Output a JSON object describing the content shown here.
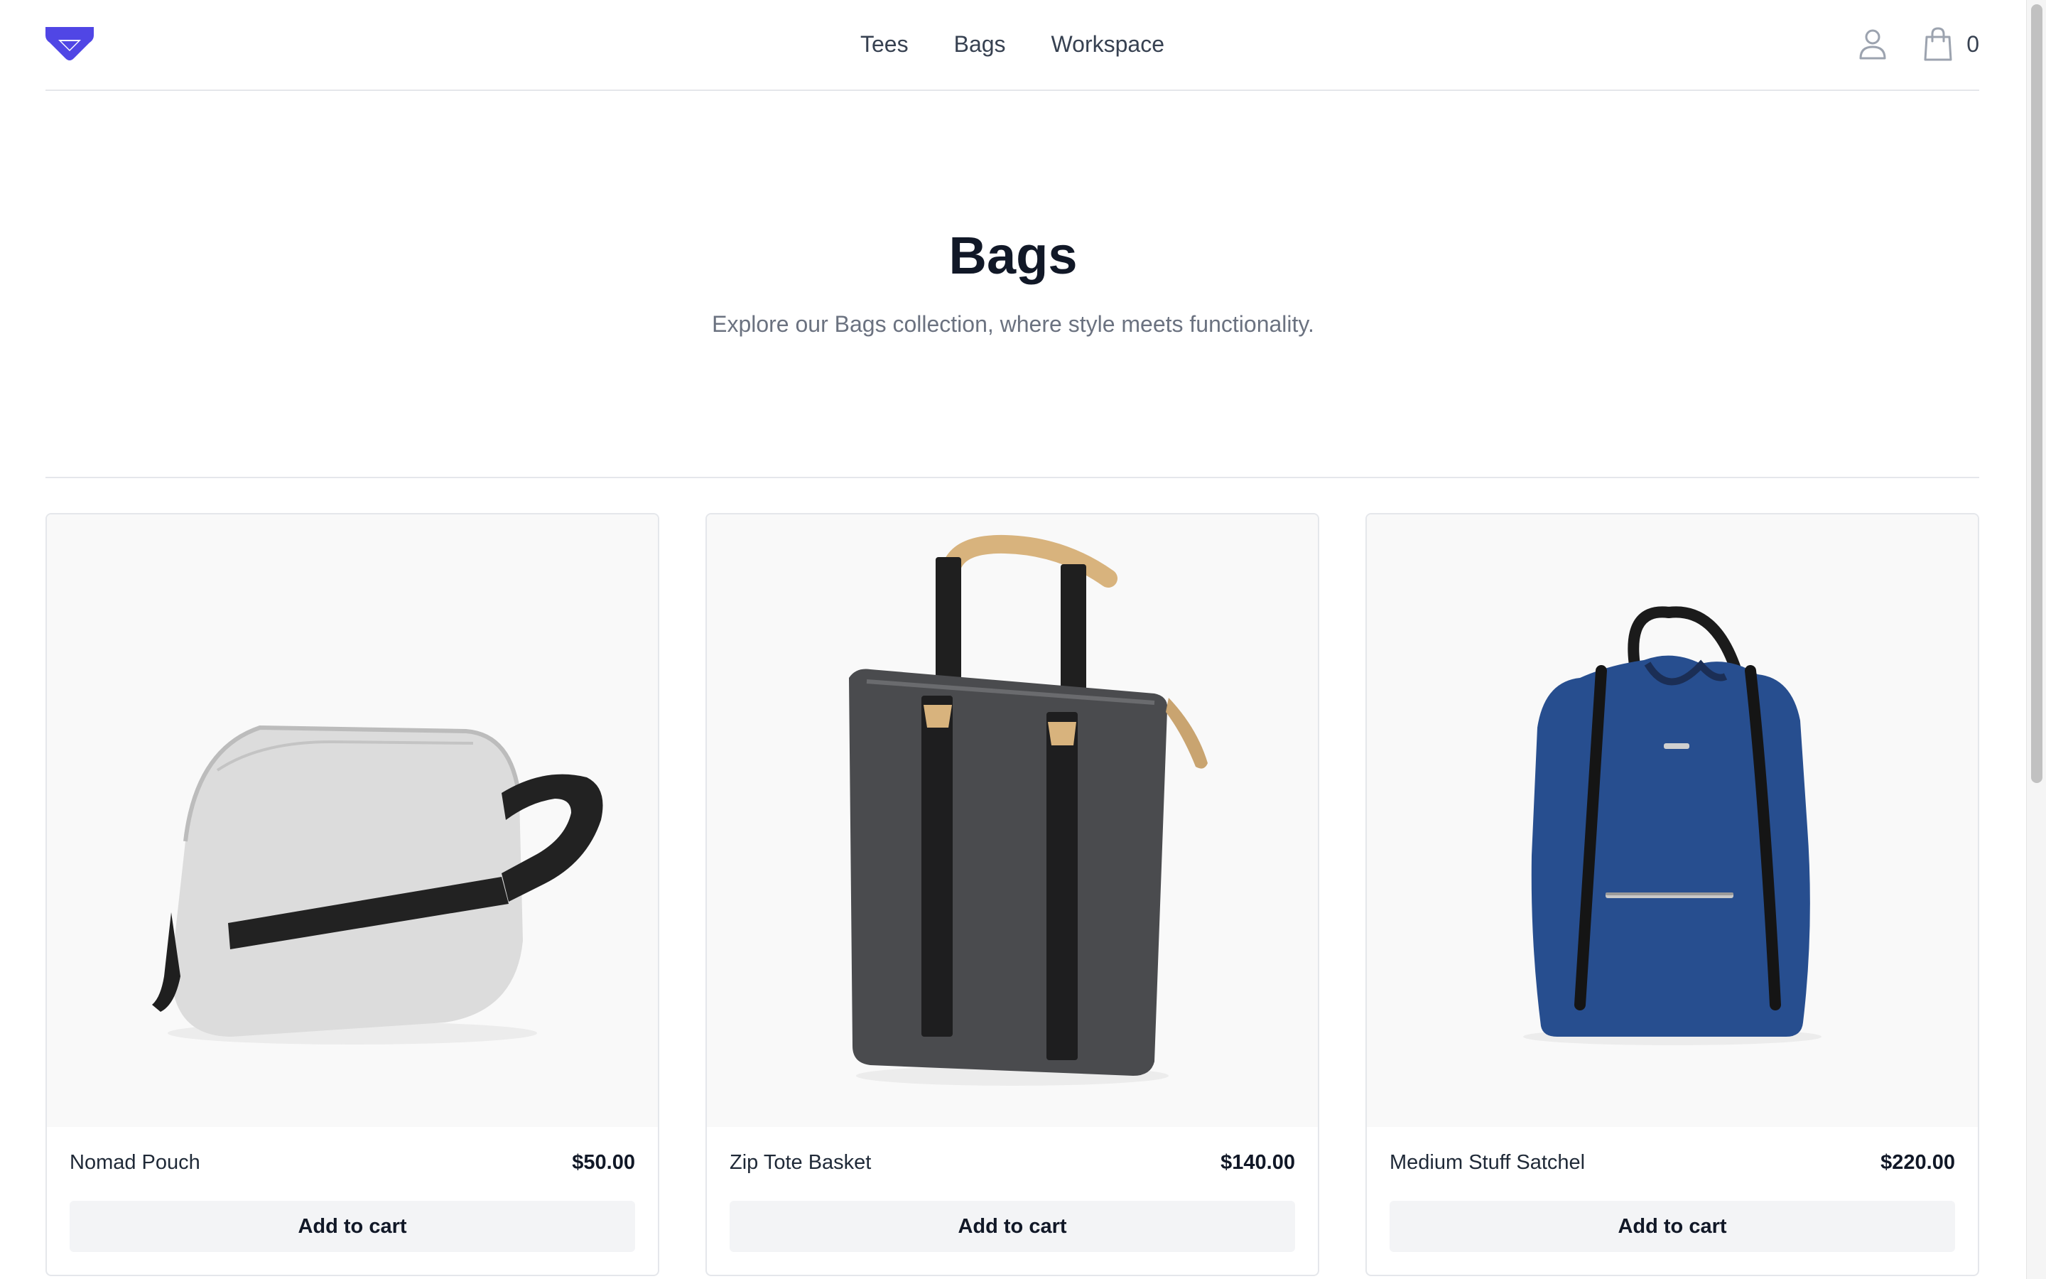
{
  "header": {
    "nav": [
      "Tees",
      "Bags",
      "Workspace"
    ],
    "cart_count": "0",
    "logo_icon": "shield-logo-icon",
    "account_icon": "user-icon",
    "cart_icon": "shopping-bag-icon",
    "brand_color": "#5046e5"
  },
  "hero": {
    "title": "Bags",
    "subtitle": "Explore our Bags collection, where style meets functionality."
  },
  "products": [
    {
      "name": "Nomad Pouch",
      "price": "$50.00",
      "button": "Add to cart",
      "image": "grey-zip-pouch-with-black-strap"
    },
    {
      "name": "Zip Tote Basket",
      "price": "$140.00",
      "button": "Add to cart",
      "image": "dark-grey-tote-with-black-straps"
    },
    {
      "name": "Medium Stuff Satchel",
      "price": "$220.00",
      "button": "Add to cart",
      "image": "blue-drawstring-backpack"
    }
  ]
}
